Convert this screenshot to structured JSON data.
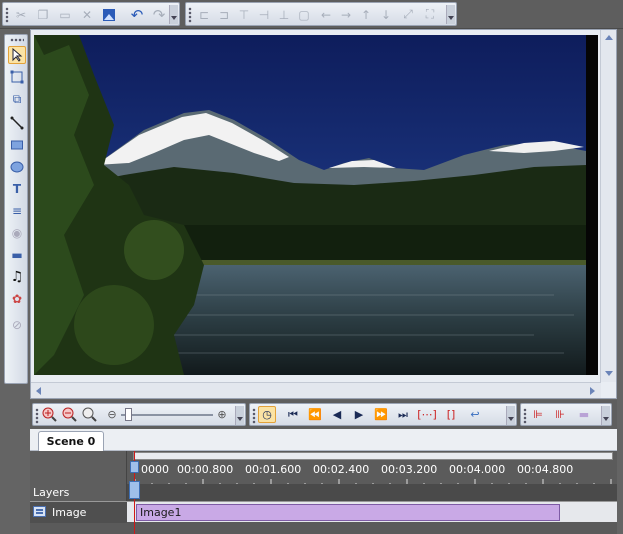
{
  "timeline": {
    "scene_tab": "Scene 0",
    "layers_label": "Layers",
    "ruler_ticks": [
      "0000",
      "00:00.800",
      "00:01.600",
      "00:02.400",
      "00:03.200",
      "00:04.000",
      "00:04.800"
    ],
    "layer": {
      "name": "Image",
      "clip_label": "Image1"
    }
  },
  "icons": {
    "top_toolbar": [
      "cut-icon",
      "copy-icon",
      "paste-icon",
      "delete-icon",
      "image-icon",
      "undo-icon",
      "redo-icon"
    ],
    "align_toolbar": [
      "align-left-icon",
      "align-center-icon",
      "align-top-icon",
      "align-right-icon",
      "align-bottom-icon",
      "group-icon",
      "nudge-left-icon",
      "nudge-right-icon",
      "nudge-up-icon",
      "nudge-down-icon",
      "resize-icon",
      "fit-icon"
    ],
    "left_tools": [
      "select-arrow-icon",
      "transform-icon",
      "crop-icon",
      "line-icon",
      "rectangle-icon",
      "ellipse-icon",
      "text-icon",
      "format-icon",
      "globe-icon",
      "button-icon",
      "music-icon",
      "effects-icon",
      "mask-icon"
    ],
    "timeline_tools": [
      "zoom-in-icon",
      "zoom-out-icon",
      "zoom-100-icon",
      "zoom-slider",
      "zoom-plus-icon",
      "snap-icon",
      "go-start-icon",
      "step-back-icon",
      "play-back-icon",
      "play-icon",
      "fast-forward-icon",
      "go-end-icon",
      "loop-icon",
      "range-icon",
      "back-icon",
      "mark-in-icon",
      "mark-out-icon",
      "trim-icon"
    ]
  },
  "colors": {
    "accent": "#2b5bb8",
    "clip": "#c9a9e6",
    "playhead": "#d01818",
    "selected_tool": "#fbe3a4"
  }
}
